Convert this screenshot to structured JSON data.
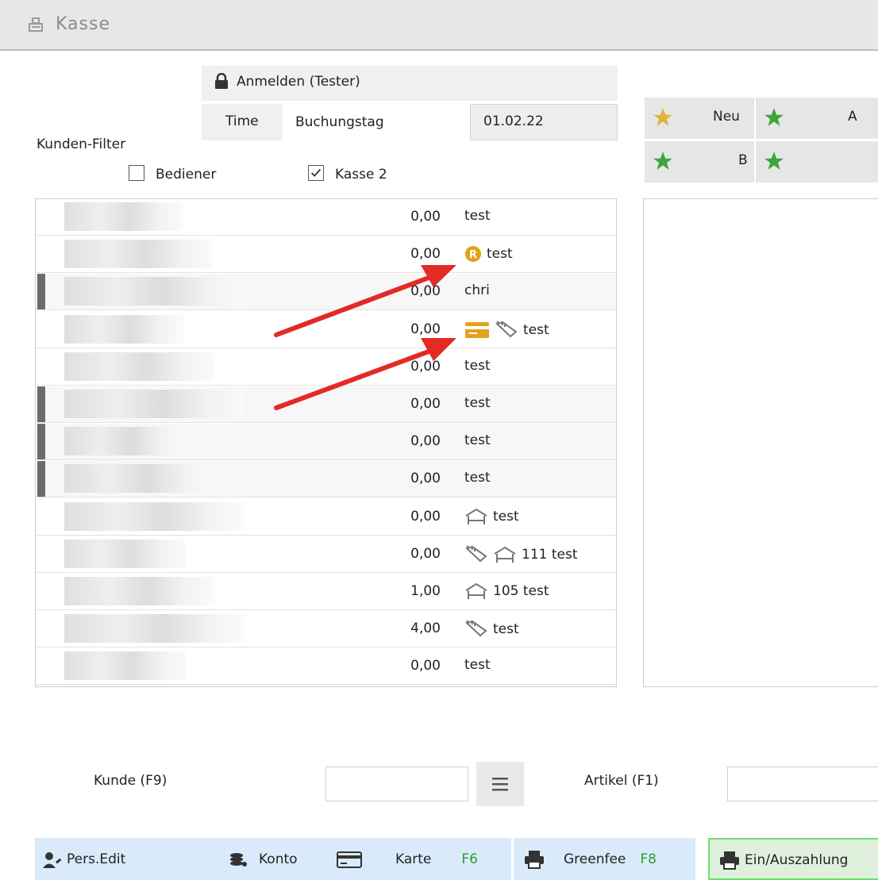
{
  "window": {
    "title": "Kasse",
    "icon": "cash-register-icon"
  },
  "login": {
    "label": "Anmelden (Tester)",
    "icon": "lock-icon"
  },
  "time": {
    "button_label": "Time",
    "field_label": "Buchungstag",
    "date": "01.02.22"
  },
  "filter": {
    "label": "Kunden-Filter",
    "bediener": {
      "label": "Bediener",
      "checked": false
    },
    "kasse2": {
      "label": "Kasse 2",
      "checked": true
    }
  },
  "rows": [
    {
      "amount": "0,00",
      "text": "test",
      "icons": [],
      "marker": false,
      "alt": false
    },
    {
      "amount": "0,00",
      "text": "test",
      "icons": [
        "r-badge-icon"
      ],
      "marker": false,
      "alt": false
    },
    {
      "amount": "0,00",
      "text": "chri",
      "icons": [],
      "marker": true,
      "alt": true
    },
    {
      "amount": "0,00",
      "text": "test",
      "icons": [
        "card-icon",
        "golf-bag-icon"
      ],
      "marker": false,
      "alt": false
    },
    {
      "amount": "0,00",
      "text": "test",
      "icons": [],
      "marker": false,
      "alt": false
    },
    {
      "amount": "0,00",
      "text": "test",
      "icons": [],
      "marker": true,
      "alt": true
    },
    {
      "amount": "0,00",
      "text": "test",
      "icons": [],
      "marker": true,
      "alt": true
    },
    {
      "amount": "0,00",
      "text": "test",
      "icons": [],
      "marker": true,
      "alt": true
    },
    {
      "amount": "0,00",
      "text": "test",
      "icons": [
        "hotel-bed-icon"
      ],
      "marker": false,
      "alt": false
    },
    {
      "amount": "0,00",
      "text": "111 test",
      "icons": [
        "golf-bag-icon",
        "hotel-bed-icon"
      ],
      "marker": false,
      "alt": false
    },
    {
      "amount": "1,00",
      "text": "105 test",
      "icons": [
        "hotel-bed-icon"
      ],
      "marker": false,
      "alt": false
    },
    {
      "amount": "4,00",
      "text": "test",
      "icons": [
        "golf-bag-icon"
      ],
      "marker": false,
      "alt": false
    },
    {
      "amount": "0,00",
      "text": "test",
      "icons": [],
      "marker": false,
      "alt": false
    }
  ],
  "favorites": [
    {
      "label": "Neu",
      "star_color": "#e1b33c"
    },
    {
      "label": "A",
      "star_color": "#3ea63a"
    },
    {
      "label": "B",
      "star_color": "#3ea63a"
    },
    {
      "label": "",
      "star_color": "#3ea63a"
    }
  ],
  "inputs": {
    "kunde_label": "Kunde (F9)",
    "artikel_label": "Artikel (F1)",
    "kunde_value": "",
    "artikel_value": ""
  },
  "bottom": {
    "pers_edit": "Pers.Edit",
    "konto": "Konto",
    "karte": "Karte",
    "karte_key": "F6",
    "greenfee": "Greenfee",
    "greenfee_key": "F8",
    "einaus": "Ein/Auszahlung"
  },
  "colors": {
    "accent_green": "#69e06a",
    "arrow_red": "#e32a25",
    "bottom_blue": "#d9ebfb",
    "icon_gold": "#e3a21a"
  }
}
